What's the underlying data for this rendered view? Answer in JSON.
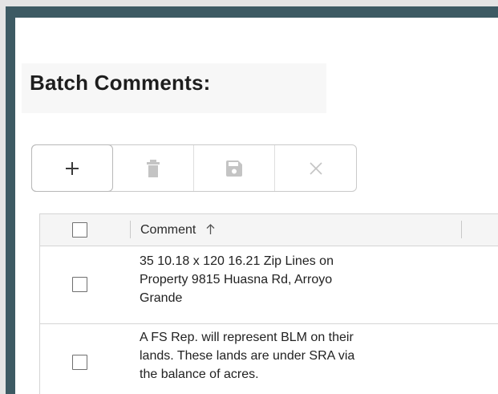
{
  "panel": {
    "title": "Batch Comments:"
  },
  "toolbar": {
    "buttons": [
      {
        "icon": "plus-icon",
        "label": "+"
      },
      {
        "icon": "trash-icon"
      },
      {
        "icon": "save-icon"
      },
      {
        "icon": "close-icon"
      }
    ]
  },
  "grid": {
    "columns": [
      {
        "label": "Comment",
        "sort": "ascending",
        "sort_icon": "arrow-up-icon"
      }
    ],
    "rows": [
      {
        "checked": false,
        "comment_lines": [
          "35 10.18 x 120 16.21 Zip Lines on",
          "Property 9815 Huasna Rd, Arroyo",
          "Grande"
        ]
      },
      {
        "checked": false,
        "comment_lines": [
          "A FS Rep. will represent BLM on their",
          "lands. These lands are under SRA via",
          "the balance of acres."
        ]
      }
    ]
  },
  "colors": {
    "panel_border": "#3d5a63",
    "header_background": "#f5f5f5",
    "icon_disabled": "#c4c4c4"
  }
}
